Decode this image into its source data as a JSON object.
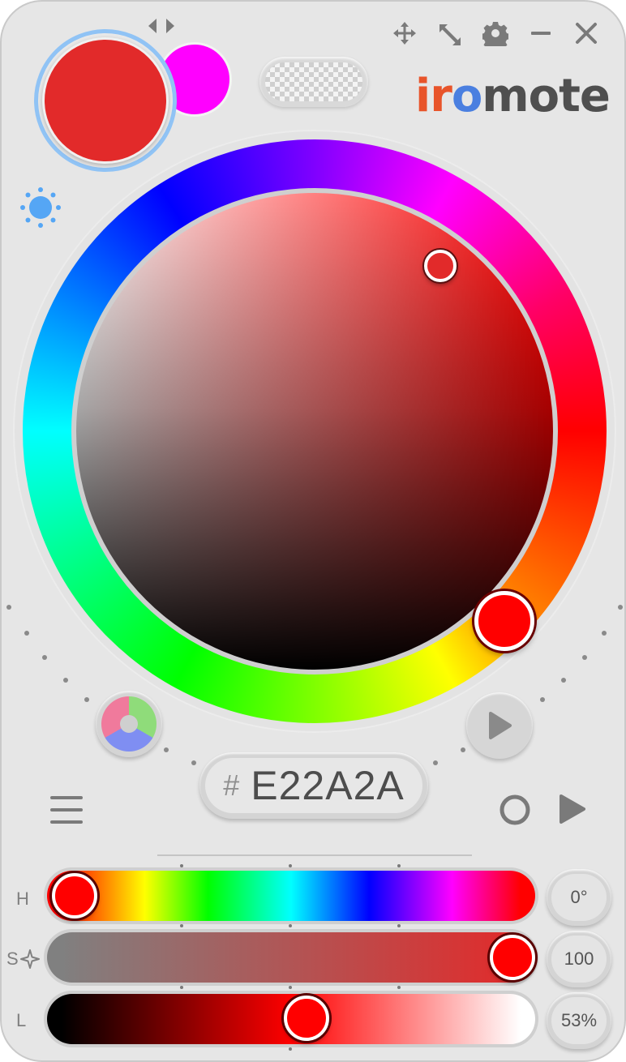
{
  "window": {
    "controls": [
      {
        "icon": "move-icon"
      },
      {
        "icon": "resize-icon"
      },
      {
        "icon": "gear-icon"
      },
      {
        "icon": "minimize-icon"
      },
      {
        "icon": "close-icon"
      }
    ]
  },
  "colors": {
    "current": "#E22A2A",
    "secondary": "#FF00FF",
    "hue_handle": "#FF0000",
    "accent_ring": "#90C3F5"
  },
  "logo": {
    "parts": [
      {
        "text": "ir",
        "color": "#E8542A"
      },
      {
        "text": "o",
        "color": "#4A7FE0"
      },
      {
        "text": "mote",
        "color": "#4F4F4F"
      }
    ]
  },
  "hex": {
    "hash": "#",
    "value": "E22A2A"
  },
  "sliders": [
    {
      "label": "H",
      "value_text": "0°",
      "position": 0.0
    },
    {
      "label": "S",
      "value_text": "100",
      "position": 1.0
    },
    {
      "label": "L",
      "value_text": "53%",
      "position": 0.53
    }
  ]
}
